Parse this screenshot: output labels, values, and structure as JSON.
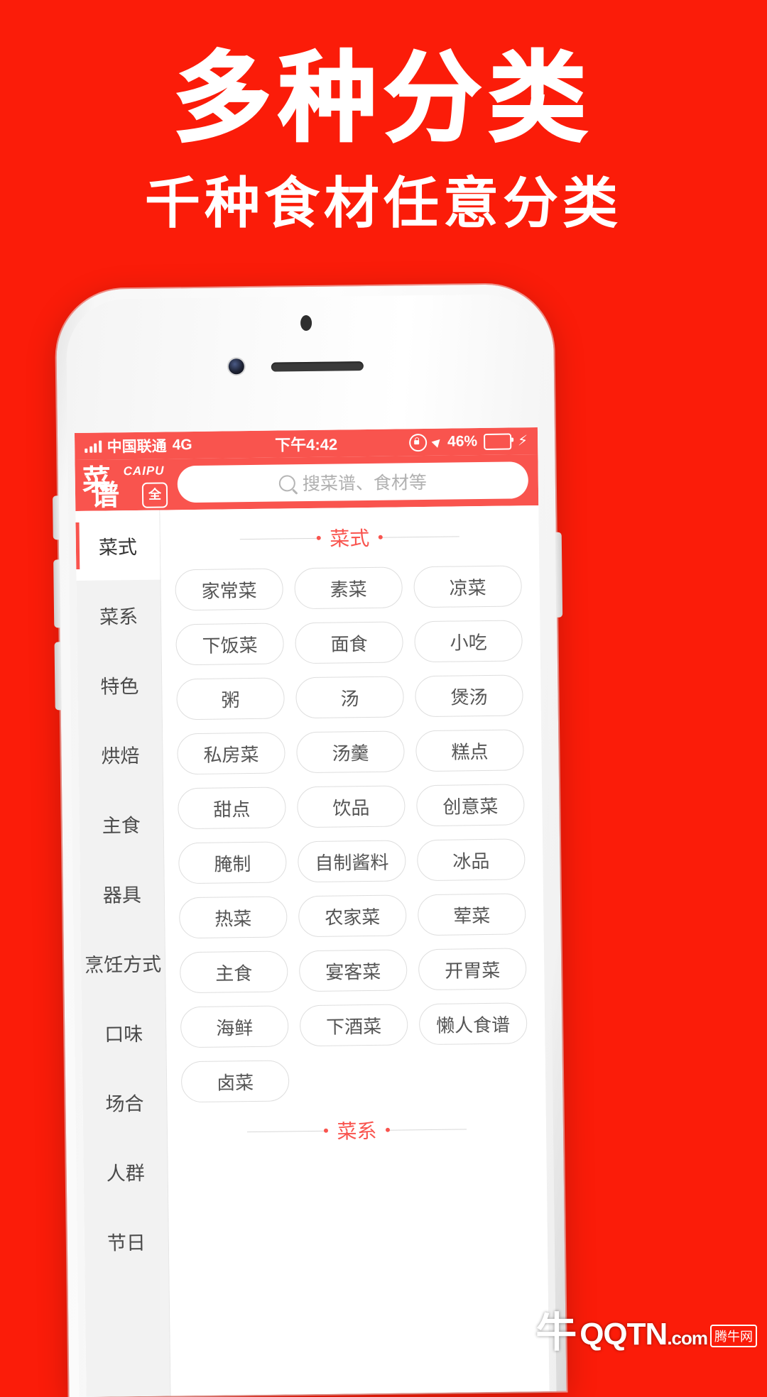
{
  "promo": {
    "title": "多种分类",
    "subtitle": "千种食材任意分类",
    "background_color": "#fb1c09"
  },
  "status_bar": {
    "carrier": "中国联通",
    "network": "4G",
    "time": "下午4:42",
    "battery_percent": "46%",
    "battery_level": 46,
    "signal_icon": "signal-bars-icon",
    "rotation_lock_icon": "rotation-lock-icon",
    "location_icon": "location-arrow-icon",
    "battery_icon": "battery-icon",
    "charging_icon": "lightning-bolt-icon",
    "background_color": "#f9544e"
  },
  "appbar": {
    "logo_line1": "菜",
    "logo_line2": "谱",
    "logo_en": "CAIPU",
    "logo_badge": "全",
    "search_placeholder": "搜菜谱、食材等",
    "search_value": "",
    "search_icon": "search-icon"
  },
  "sidebar": {
    "active_index": 0,
    "items": [
      {
        "label": "菜式"
      },
      {
        "label": "菜系"
      },
      {
        "label": "特色"
      },
      {
        "label": "烘焙"
      },
      {
        "label": "主食"
      },
      {
        "label": "器具"
      },
      {
        "label": "烹饪方式"
      },
      {
        "label": "口味"
      },
      {
        "label": "场合"
      },
      {
        "label": "人群"
      },
      {
        "label": "节日"
      }
    ]
  },
  "panel": {
    "sections": [
      {
        "title": "菜式",
        "tags": [
          "家常菜",
          "素菜",
          "凉菜",
          "下饭菜",
          "面食",
          "小吃",
          "粥",
          "汤",
          "煲汤",
          "私房菜",
          "汤羹",
          "糕点",
          "甜点",
          "饮品",
          "创意菜",
          "腌制",
          "自制酱料",
          "冰品",
          "热菜",
          "农家菜",
          "荤菜",
          "主食",
          "宴客菜",
          "开胃菜",
          "海鲜",
          "下酒菜",
          "懒人食谱",
          "卤菜"
        ]
      },
      {
        "title": "菜系",
        "tags": []
      }
    ]
  },
  "watermark": {
    "site": "QQTN",
    "domain": ".com",
    "chip": "腾牛网",
    "mark": "牛"
  }
}
